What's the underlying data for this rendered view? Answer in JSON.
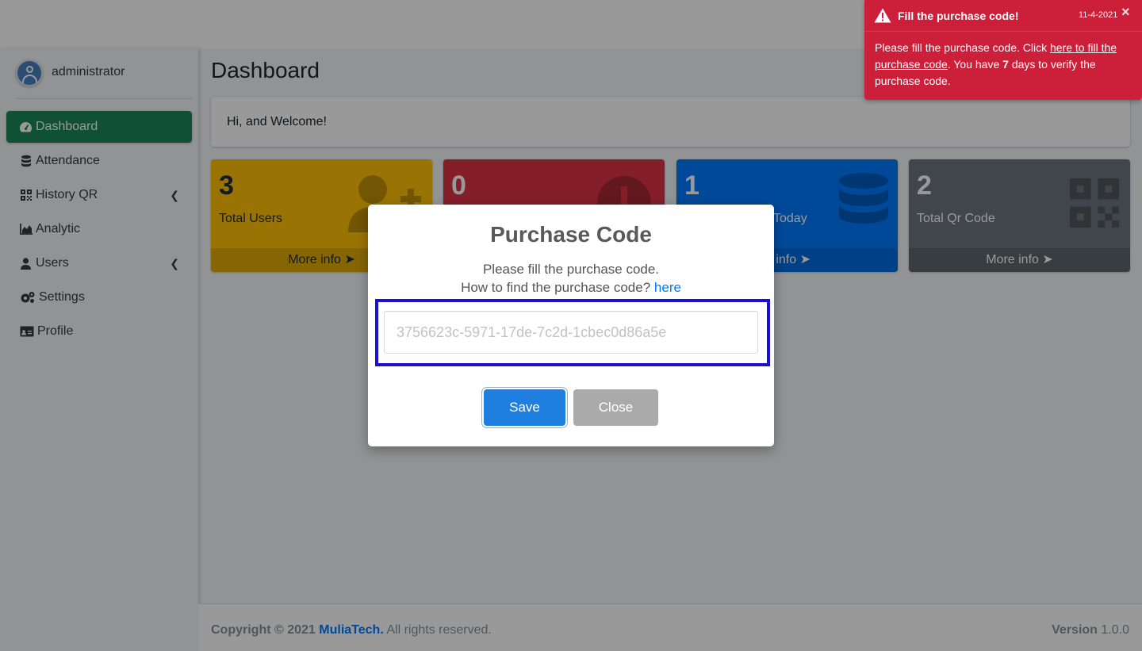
{
  "user": {
    "name": "administrator"
  },
  "sidebar": {
    "items": [
      {
        "label": "Dashboard",
        "icon": "tachometer-icon"
      },
      {
        "label": "Attendance",
        "icon": "database-icon"
      },
      {
        "label": "History QR",
        "icon": "qrcode-icon"
      },
      {
        "label": "Analytic",
        "icon": "chart-area-icon"
      },
      {
        "label": "Users",
        "icon": "user-icon"
      },
      {
        "label": "Settings",
        "icon": "cogs-icon"
      },
      {
        "label": "Profile",
        "icon": "id-card-icon"
      }
    ]
  },
  "page": {
    "title": "Dashboard",
    "welcome": "Hi, and Welcome!"
  },
  "boxes": [
    {
      "value": "3",
      "label": "Total Users",
      "more": "More info",
      "color": "#ffc107"
    },
    {
      "value": "0",
      "label": "",
      "more": "",
      "color": "#dc3545"
    },
    {
      "value": "1",
      "label": "Today",
      "more": "e info",
      "color": "#007bff"
    },
    {
      "value": "2",
      "label": "Total Qr Code",
      "more": "More info",
      "color": "#6c757d"
    }
  ],
  "footer": {
    "copyright": "Copyright © 2021",
    "brand": "MuliaTech.",
    "rights": "All rights reserved.",
    "version_label": "Version",
    "version": "1.0.0"
  },
  "modal": {
    "title": "Purchase Code",
    "line1": "Please fill the purchase code.",
    "line2": "How to find the purchase code?",
    "link": "here",
    "placeholder": "3756623c-5971-17de-7c2d-1cbec0d86a5e",
    "save": "Save",
    "close": "Close"
  },
  "toast": {
    "title": "Fill the purchase code!",
    "date": "11-4-2021",
    "close": "×",
    "text1": "Please fill the purchase code. Click",
    "link": "here to fill the purchase code",
    "text2": ". You have",
    "days": "7",
    "text3": "days to verify the purchase code.",
    "color": "#cb1f3a"
  }
}
